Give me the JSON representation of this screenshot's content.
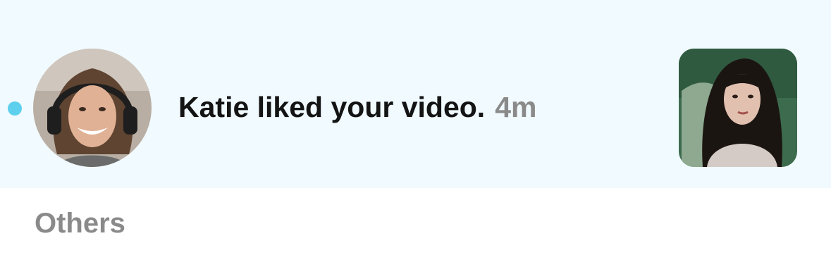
{
  "notification": {
    "text": "Katie liked your video.",
    "time": "4m",
    "unread": true,
    "avatar_icon": "person-avatar",
    "thumbnail_icon": "video-thumbnail"
  },
  "sections": {
    "others_label": "Others"
  },
  "colors": {
    "highlight_bg": "#f1fafe",
    "unread_dot": "#5ed0ed",
    "text_primary": "#141414",
    "text_secondary": "#8a8a8a"
  }
}
